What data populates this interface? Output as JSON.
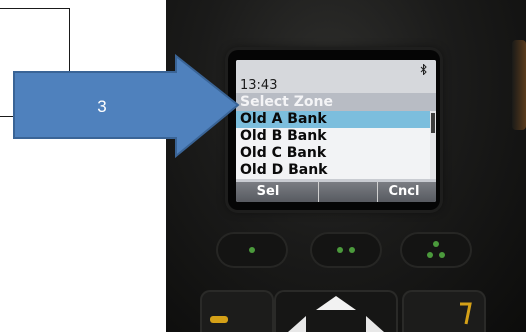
{
  "callout": {
    "label": "3",
    "color": "#4f81bd",
    "stroke": "#3a6496"
  },
  "phone": {
    "status": {
      "time": "13:43",
      "bluetooth_icon": "bluetooth-icon"
    },
    "header": "Select Zone",
    "zones": [
      {
        "label": "Old A Bank",
        "selected": true
      },
      {
        "label": "Old B Bank",
        "selected": false
      },
      {
        "label": "Old C Bank",
        "selected": false
      },
      {
        "label": "Old D Bank",
        "selected": false
      }
    ],
    "softkeys": {
      "left": "Sel",
      "right": "Cncl"
    },
    "nav_buttons": [
      "one-dot-icon",
      "two-dot-icon",
      "three-dot-icon"
    ],
    "colors": {
      "highlight": "#7cbedd",
      "softkey_bar": "#575a60",
      "button_led": "#4b9a3c"
    }
  }
}
